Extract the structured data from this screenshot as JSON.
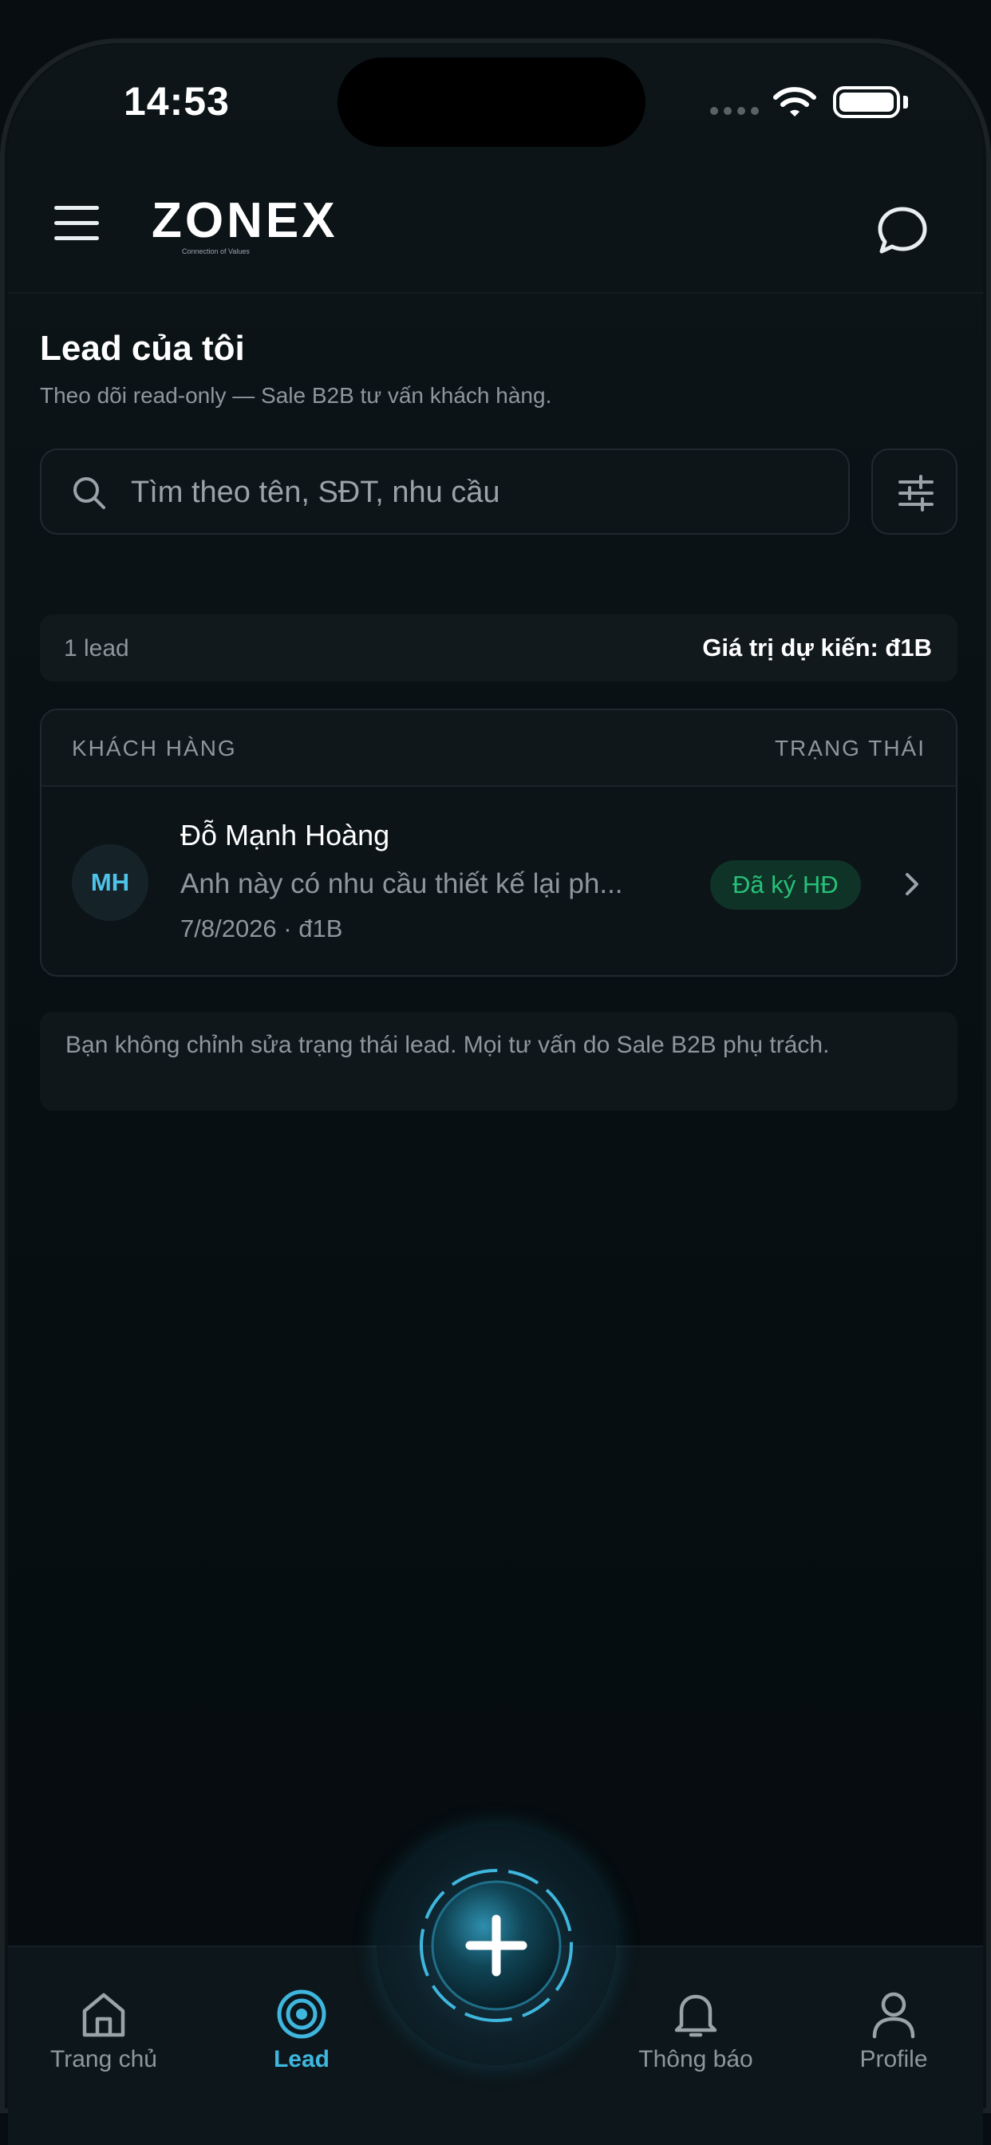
{
  "status": {
    "time": "14:53"
  },
  "header": {
    "logo": "ZONEX",
    "logo_tagline": "Connection of Values"
  },
  "page": {
    "title": "Lead của tôi",
    "subtitle": "Theo dõi read-only — Sale B2B tư vấn khách hàng."
  },
  "search": {
    "placeholder": "Tìm theo tên, SĐT, nhu cầu",
    "value": ""
  },
  "summary": {
    "count": "1 lead",
    "expected_value": "Giá trị dự kiến: đ1B"
  },
  "table": {
    "columns": [
      "KHÁCH HÀNG",
      "TRẠNG THÁI"
    ],
    "rows": [
      {
        "initials": "MH",
        "name": "Đỗ Mạnh Hoàng",
        "description": "Anh này có nhu cầu thiết kế lại ph...",
        "meta": "7/8/2026 · đ1B",
        "status": "Đã ký HĐ"
      }
    ]
  },
  "note": "Bạn không chỉnh sửa trạng thái lead. Mọi tư vấn do Sale B2B phụ trách.",
  "tabbar": {
    "items": [
      {
        "label": "Trang chủ",
        "icon": "home-icon"
      },
      {
        "label": "Lead",
        "icon": "target-icon",
        "active": true
      },
      {
        "label": "Thông báo",
        "icon": "bell-icon"
      },
      {
        "label": "Profile",
        "icon": "user-icon"
      }
    ],
    "fab_icon": "plus-icon"
  },
  "colors": {
    "accent": "#3fb6dd",
    "status_green": "#27c07a",
    "background": "#070d10"
  }
}
